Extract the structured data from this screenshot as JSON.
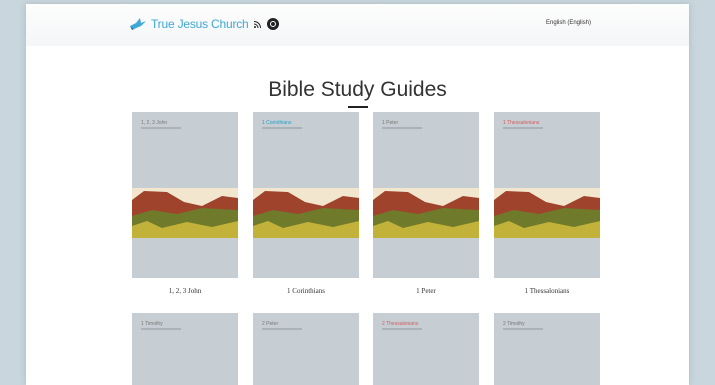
{
  "header": {
    "logo_text": "True Jesus Church",
    "language": "English (English)"
  },
  "page": {
    "title": "Bible Study Guides"
  },
  "colors": {
    "logo_blue": "#3fa8d6",
    "cover_gray": "#c6ced4",
    "accent_teal": "#2a9cc0",
    "accent_red": "#d05c5c"
  },
  "guides_row1": [
    {
      "label": "1, 2, 3 John",
      "series": "1, 2, 3 John",
      "series_color": "#777777"
    },
    {
      "label": "1 Corinthians",
      "series": "1 Corinthians",
      "series_color": "#2a9cc0"
    },
    {
      "label": "1 Peter",
      "series": "1 Peter",
      "series_color": "#777777"
    },
    {
      "label": "1 Thessalonians",
      "series": "1 Thessalonians",
      "series_color": "#d05c5c"
    }
  ],
  "guides_row2": [
    {
      "series": "1 Timothy"
    },
    {
      "series": "2 Peter"
    },
    {
      "series": "2 Thessalonians"
    },
    {
      "series": "2 Timothy"
    }
  ]
}
